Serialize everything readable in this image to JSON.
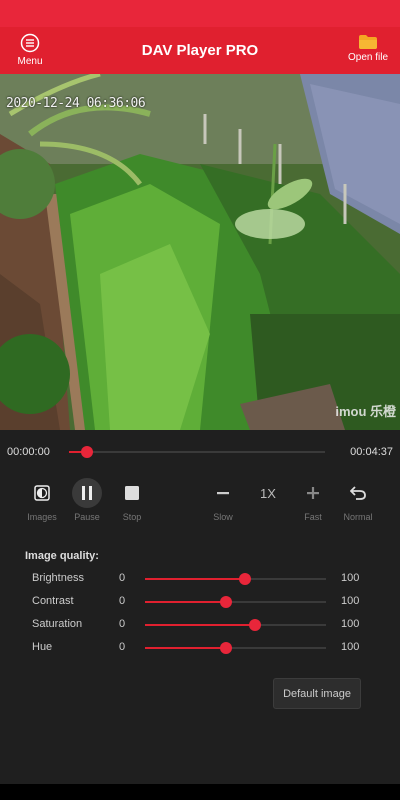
{
  "colors": {
    "accent": "#e0202f",
    "status_bar": "#e8263a",
    "background": "#1f1f1f",
    "folder": "#f5a623"
  },
  "header": {
    "menu_label": "Menu",
    "menu_icon": "menu-circle-icon",
    "title": "DAV Player PRO",
    "open_label": "Open file",
    "open_icon": "folder-icon"
  },
  "video": {
    "timestamp": "2020-12-24 06:36:06",
    "watermark": "imou 乐橙"
  },
  "playback": {
    "current_time": "00:00:00",
    "total_time": "00:04:37",
    "progress_fraction": 0.07
  },
  "controls": {
    "images": {
      "label": "Images",
      "icon": "image-adjust-icon"
    },
    "pause": {
      "label": "Pause",
      "icon": "pause-icon"
    },
    "stop": {
      "label": "Stop",
      "icon": "stop-icon"
    },
    "slow": {
      "label": "Slow",
      "icon": "minus-icon"
    },
    "speed": "1X",
    "fast": {
      "label": "Fast",
      "icon": "plus-icon"
    },
    "normal": {
      "label": "Normal",
      "icon": "undo-icon"
    }
  },
  "image_quality": {
    "title": "Image quality:",
    "items": [
      {
        "label": "Brightness",
        "min": "0",
        "max": "100",
        "value": 55
      },
      {
        "label": "Contrast",
        "min": "0",
        "max": "100",
        "value": 45
      },
      {
        "label": "Saturation",
        "min": "0",
        "max": "100",
        "value": 61
      },
      {
        "label": "Hue",
        "min": "0",
        "max": "100",
        "value": 45
      }
    ],
    "default_button": "Default image"
  }
}
